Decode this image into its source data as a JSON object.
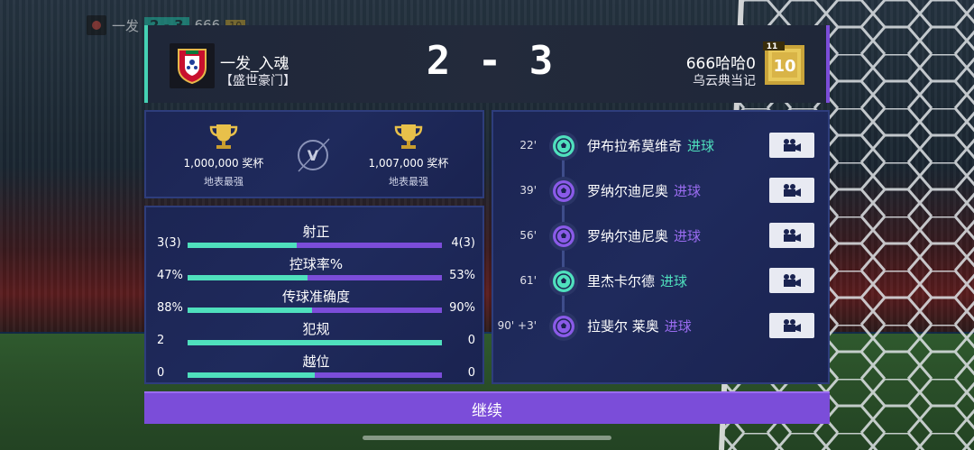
{
  "mini_scoreboard": {
    "team": "一发",
    "score": "2 - 3",
    "prefix": "666",
    "ovr": "10"
  },
  "match": {
    "home": {
      "name": "一发_入魂",
      "club": "【盛世豪门】"
    },
    "away": {
      "name": "666哈哈0",
      "club": "乌云典当记",
      "ovr_small": "11",
      "ovr_big": "10"
    },
    "score": "2 - 3"
  },
  "trophies": {
    "home": {
      "amount": "1,000,000 奖杯",
      "title": "地表最强"
    },
    "away": {
      "amount": "1,007,000 奖杯",
      "title": "地表最强"
    },
    "vs_label": "V"
  },
  "stats": [
    {
      "label": "射正",
      "left": "3(3)",
      "right": "4(3)",
      "home_share": 0.43
    },
    {
      "label": "控球率%",
      "left": "47%",
      "right": "53%",
      "home_share": 0.47
    },
    {
      "label": "传球准确度",
      "left": "88%",
      "right": "90%",
      "home_share": 0.49
    },
    {
      "label": "犯规",
      "left": "2",
      "right": "0",
      "home_share": 1.0
    },
    {
      "label": "越位",
      "left": "0",
      "right": "0",
      "home_share": 0.5
    }
  ],
  "events": [
    {
      "minute": "22'",
      "player": "伊布拉希莫维奇",
      "type": "进球",
      "side": "home"
    },
    {
      "minute": "39'",
      "player": "罗纳尔迪尼奥",
      "type": "进球",
      "side": "away"
    },
    {
      "minute": "56'",
      "player": "罗纳尔迪尼奥",
      "type": "进球",
      "side": "away"
    },
    {
      "minute": "61'",
      "player": "里杰卡尔德",
      "type": "进球",
      "side": "home"
    },
    {
      "minute": "90' +3'",
      "player": "拉斐尔 莱奥",
      "type": "进球",
      "side": "away"
    }
  ],
  "continue_label": "继续",
  "colors": {
    "home": "#4fe0bd",
    "away": "#7b4dd9",
    "panel": "#1f2a5c"
  }
}
